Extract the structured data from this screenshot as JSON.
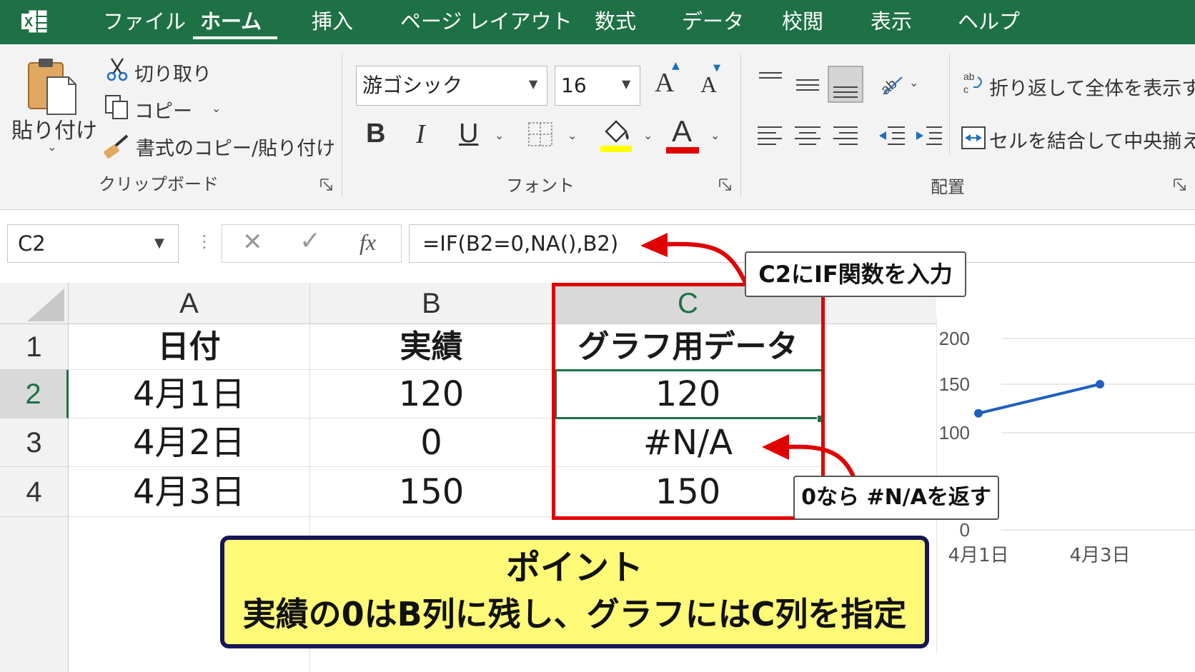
{
  "app": {
    "logo_letter": "X",
    "menu_tabs": [
      "ファイル",
      "ホーム",
      "挿入",
      "ページ レイアウト",
      "数式",
      "データ",
      "校閲",
      "表示",
      "ヘルプ"
    ],
    "active_tab": "ホーム"
  },
  "ribbon": {
    "clipboard": {
      "paste_label": "貼り付け",
      "cut_label": "切り取り",
      "copy_label": "コピー",
      "format_painter_label": "書式のコピー/貼り付け",
      "group_label": "クリップボード"
    },
    "font": {
      "font_name": "游ゴシック",
      "font_size": "16",
      "bold_glyph": "B",
      "italic_glyph": "I",
      "underline_glyph": "U",
      "grow_glyph": "A",
      "shrink_glyph": "A",
      "font_color_glyph": "A",
      "group_label": "フォント",
      "fill_color": "#ffff00",
      "font_color": "#e00000"
    },
    "alignment": {
      "wrap_text_label": "折り返して全体を表示する",
      "merge_center_label": "セルを結合して中央揃え",
      "group_label": "配置"
    }
  },
  "formula_bar": {
    "name_box": "C2",
    "fx_glyph": "fx",
    "formula": "=IF(B2=0,NA(),B2)"
  },
  "sheet": {
    "columns": [
      "A",
      "B",
      "C"
    ],
    "rows": [
      {
        "num": "1",
        "a": "日付",
        "b": "実績",
        "c": "グラフ用データ"
      },
      {
        "num": "2",
        "a": "4月1日",
        "b": "120",
        "c": "120"
      },
      {
        "num": "3",
        "a": "4月2日",
        "b": "0",
        "c": "#N/A"
      },
      {
        "num": "4",
        "a": "4月3日",
        "b": "150",
        "c": "150"
      }
    ],
    "active_cell": "C2"
  },
  "annotations": {
    "formula_callout": "C2にIF関数を入力",
    "na_callout": "0なら #N/Aを返す",
    "point_title": "ポイント",
    "point_body": "実績の0はB列に残し、グラフにはC列を指定",
    "highlight_color": "#e00000",
    "point_bg": "#fff978",
    "point_border": "#151554"
  },
  "chart_data": {
    "type": "line",
    "categories": [
      "4月1日",
      "4月2日",
      "4月3日"
    ],
    "x_tick_labels": [
      "4月1日",
      "4月3日"
    ],
    "series": [
      {
        "values": [
          120,
          null,
          150
        ],
        "color": "#1f5fbf"
      }
    ],
    "y_ticks": [
      "200",
      "150",
      "100",
      "0"
    ],
    "ylim": [
      0,
      200
    ],
    "grid": true
  }
}
